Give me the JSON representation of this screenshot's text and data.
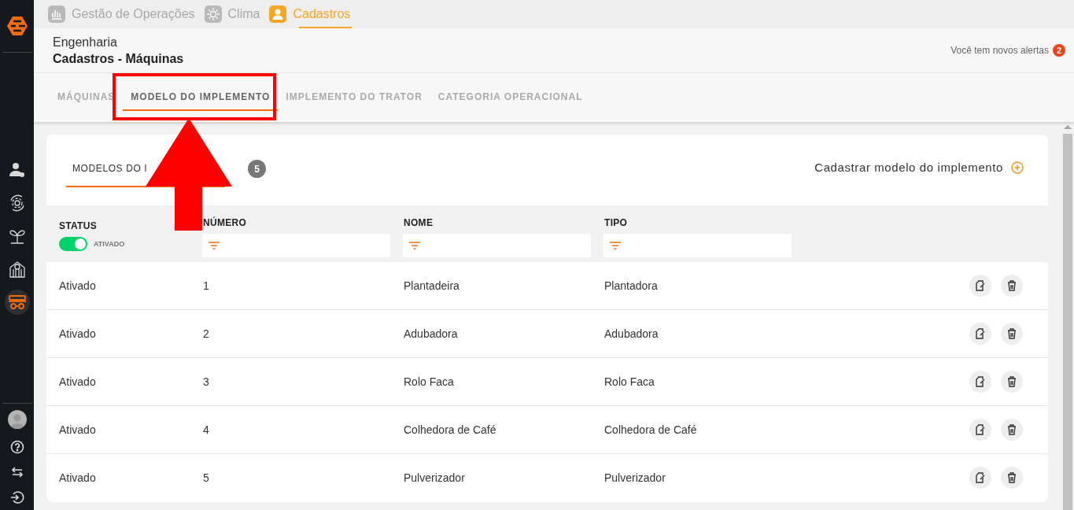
{
  "sidebar": {
    "items": [
      {
        "kind": "user-settings",
        "selected": false
      },
      {
        "kind": "gear-cycle",
        "selected": false
      },
      {
        "kind": "sprout",
        "selected": false
      },
      {
        "kind": "silo",
        "selected": false
      },
      {
        "kind": "tractor",
        "selected": true
      }
    ],
    "bottom": [
      {
        "kind": "avatar"
      },
      {
        "kind": "help"
      },
      {
        "kind": "swap"
      },
      {
        "kind": "logout"
      }
    ]
  },
  "top_nav": {
    "tabs": [
      {
        "label": "Gestão de Operações",
        "selected": false
      },
      {
        "label": "Clima",
        "selected": false
      },
      {
        "label": "Cadastros",
        "selected": true
      }
    ]
  },
  "header": {
    "section": "Engenharia",
    "title": "Cadastros - Máquinas",
    "alerts": {
      "text": "Você tem novos alertas",
      "count": "2"
    }
  },
  "tabs": [
    {
      "label": "MÁQUINAS",
      "selected": false
    },
    {
      "label": "MODELO DO IMPLEMENTO",
      "selected": true
    },
    {
      "label": "IMPLEMENTO DO TRATOR",
      "selected": false
    },
    {
      "label": "CATEGORIA OPERACIONAL",
      "selected": false
    }
  ],
  "card": {
    "subtab": {
      "label_parts": [
        "MODELOS DO I"
      ],
      "selected": true
    },
    "count": "5",
    "add_label": "Cadastrar modelo do implemento",
    "table": {
      "status_header": "STATUS",
      "status_filter": {
        "label": "ATIVADO",
        "on": true
      },
      "columns": [
        "NÚMERO",
        "NOME",
        "TIPO"
      ],
      "rows": [
        {
          "status": "Ativado",
          "numero": "1",
          "nome": "Plantadeira",
          "tipo": "Plantadora"
        },
        {
          "status": "Ativado",
          "numero": "2",
          "nome": "Adubadora",
          "tipo": "Adubadora"
        },
        {
          "status": "Ativado",
          "numero": "3",
          "nome": "Rolo Faca",
          "tipo": "Rolo Faca"
        },
        {
          "status": "Ativado",
          "numero": "4",
          "nome": "Colhedora de Café",
          "tipo": "Colhedora de Café"
        },
        {
          "status": "Ativado",
          "numero": "5",
          "nome": "Pulverizador",
          "tipo": "Pulverizador"
        }
      ]
    }
  }
}
